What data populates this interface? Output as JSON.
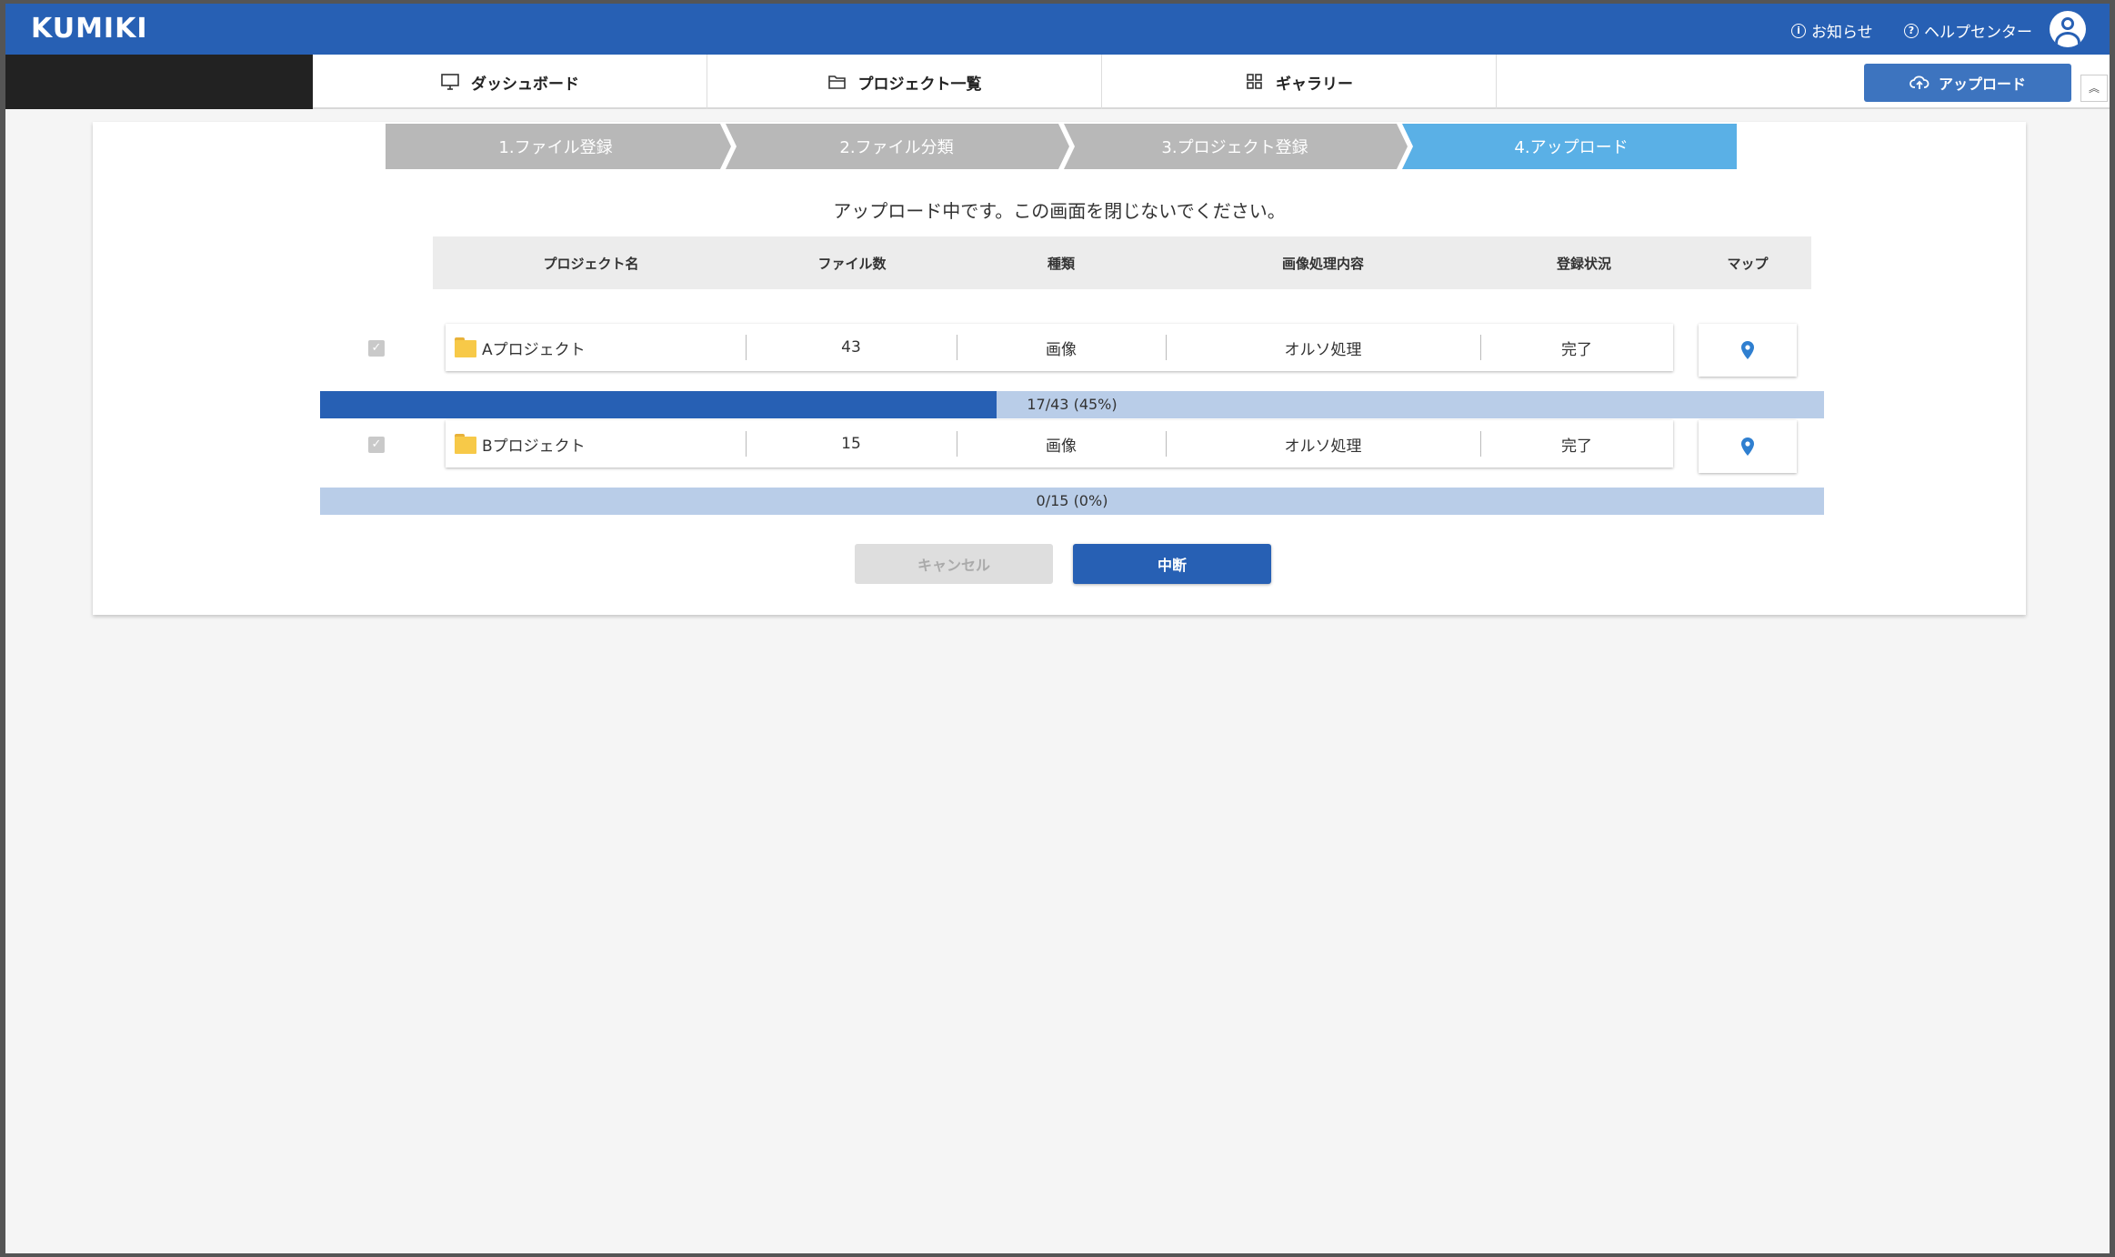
{
  "header": {
    "logo": "KUMIKI",
    "notice_link": "お知らせ",
    "help_link": "ヘルプセンター"
  },
  "nav": {
    "tabs": [
      {
        "label": "ダッシュボード",
        "icon": "monitor-icon"
      },
      {
        "label": "プロジェクト一覧",
        "icon": "folder-open-icon"
      },
      {
        "label": "ギャラリー",
        "icon": "grid-icon"
      }
    ],
    "upload_label": "アップロード"
  },
  "steps": [
    {
      "label": "1.ファイル登録",
      "active": false
    },
    {
      "label": "2.ファイル分類",
      "active": false
    },
    {
      "label": "3.プロジェクト登録",
      "active": false
    },
    {
      "label": "4.アップロード",
      "active": true
    }
  ],
  "colors": {
    "primary": "#2760b4",
    "step_inactive": "#b8b8b8",
    "step_active": "#5ab0e6",
    "progress_bg": "#b9cde8",
    "pin": "#2f7fd0"
  },
  "message": "アップロード中です。この画面を閉じないでください。",
  "table": {
    "headers": [
      "プロジェクト名",
      "ファイル数",
      "種類",
      "画像処理内容",
      "登録状況",
      "マップ"
    ],
    "rows": [
      {
        "checked": true,
        "name": "Aプロジェクト",
        "files": "43",
        "type": "画像",
        "processing": "オルソ処理",
        "status": "完了",
        "progress_label": "17/43 (45%)",
        "progress": 0.45
      },
      {
        "checked": true,
        "name": "Bプロジェクト",
        "files": "15",
        "type": "画像",
        "processing": "オルソ処理",
        "status": "完了",
        "progress_label": "0/15 (0%)",
        "progress": 0
      }
    ]
  },
  "buttons": {
    "cancel": "キャンセル",
    "stop": "中断"
  }
}
